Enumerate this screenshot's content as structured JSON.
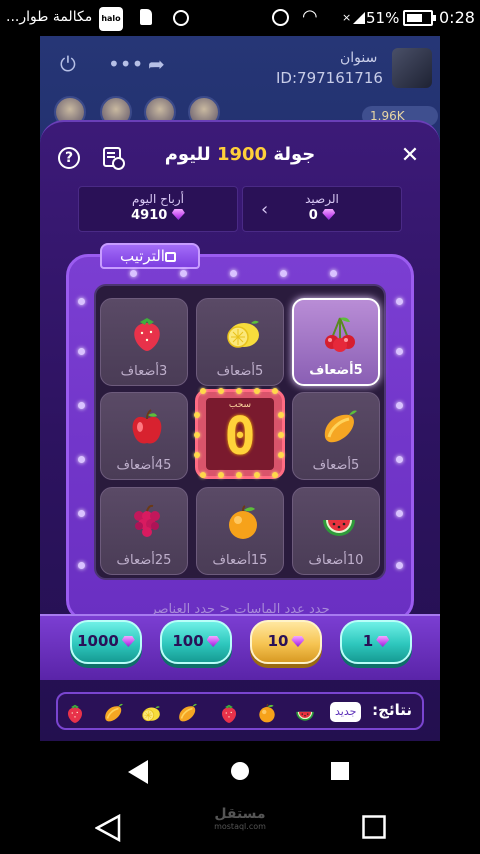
{
  "status_bar": {
    "notification_text": "مكالمة طوار...",
    "app_badge": "halo",
    "battery_percent": "51%",
    "time": "0:28"
  },
  "room": {
    "host_name": "سنوان",
    "host_id": "ID:797161716",
    "coins": "1.96K"
  },
  "modal": {
    "title_prefix": "جولة",
    "title_number": "1900",
    "title_suffix": "لليوم",
    "balance_label": "الرصيد",
    "balance_value": "0",
    "earnings_label": "أرباح اليوم",
    "earnings_value": "4910"
  },
  "ranking_tab": "الترتيب",
  "tiles": [
    {
      "fruit": "strawberry-icon",
      "label": "3أضعاف"
    },
    {
      "fruit": "lemon-icon",
      "label": "5أضعاف"
    },
    {
      "fruit": "cherry-icon",
      "label": "5أضعاف"
    },
    {
      "fruit": "apple-icon",
      "label": "45أضعاف"
    },
    {
      "fruit": "mango-icon",
      "label": "5أضعاف"
    },
    {
      "fruit": "grape-icon",
      "label": "25أضعاف"
    },
    {
      "fruit": "orange-icon",
      "label": "15أضعاف"
    },
    {
      "fruit": "watermelon-icon",
      "label": "10أضعاف"
    }
  ],
  "active_tile": "cherry-icon",
  "center": {
    "label": "سحب",
    "countdown": "0"
  },
  "rules_text": "حدد عدد الماسات < حدد العناصر",
  "bets": [
    {
      "value": "1000",
      "selected": false
    },
    {
      "value": "100",
      "selected": false
    },
    {
      "value": "10",
      "selected": true
    },
    {
      "value": "1",
      "selected": false
    }
  ],
  "results": {
    "label": "نتائج:",
    "new_badge": "جديد",
    "fruits": [
      "strawberry-icon",
      "mango-icon",
      "lemon-icon",
      "mango-icon",
      "strawberry-icon",
      "orange-icon",
      "watermelon-icon"
    ]
  },
  "watermark": {
    "text": "مستقل",
    "domain": "mostaql.com"
  },
  "colors": {
    "accent_gold": "#ffcf3a",
    "modal_purple": "#3c1a78",
    "bet_teal": "#2ec7bd",
    "bet_selected_gold": "#f6c452"
  }
}
